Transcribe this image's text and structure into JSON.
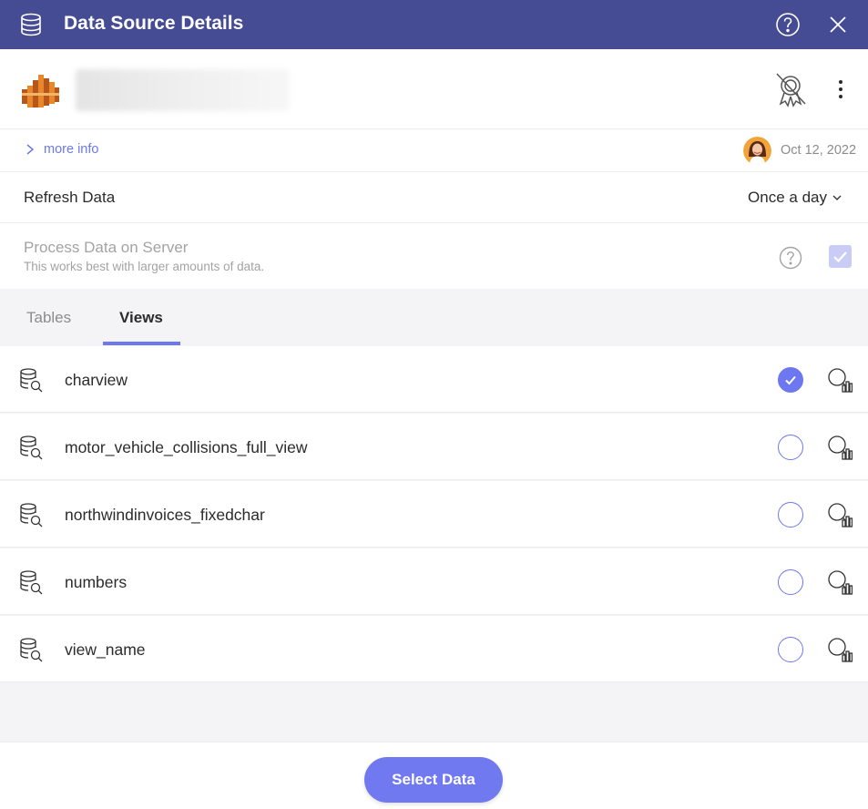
{
  "header": {
    "title": "Data Source Details",
    "icons": [
      "database-icon",
      "help-circle-icon",
      "close-icon"
    ],
    "background": "#454c93"
  },
  "source": {
    "logo": "redshift-logo",
    "actions": [
      "certification-off-icon",
      "kebab-menu-icon"
    ]
  },
  "info": {
    "more_info_label": "more info",
    "date": "Oct 12, 2022"
  },
  "refresh": {
    "label": "Refresh Data",
    "value": "Once a day"
  },
  "process": {
    "label": "Process Data on Server",
    "sublabel": "This works best with larger amounts of data.",
    "checked": true,
    "disabled": true
  },
  "tabs": [
    {
      "label": "Tables",
      "active": false
    },
    {
      "label": "Views",
      "active": true
    }
  ],
  "views": [
    {
      "name": "charview",
      "selected": true
    },
    {
      "name": "motor_vehicle_collisions_full_view",
      "selected": false
    },
    {
      "name": "northwindinvoices_fixedchar",
      "selected": false
    },
    {
      "name": "numbers",
      "selected": false
    },
    {
      "name": "view_name",
      "selected": false
    }
  ],
  "footer": {
    "select_label": "Select Data"
  },
  "colors": {
    "accent": "#6d78f0",
    "header": "#454c93",
    "logo_orange": "#e8882b"
  }
}
